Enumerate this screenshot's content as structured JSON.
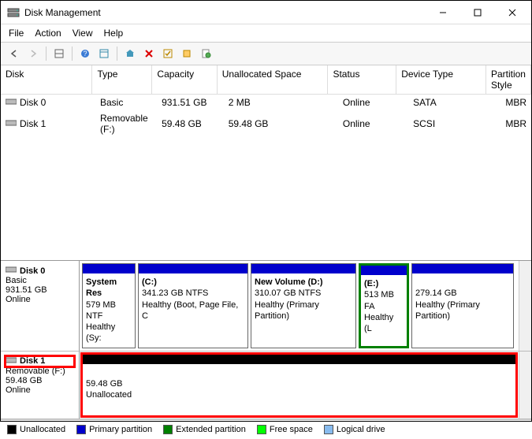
{
  "window": {
    "title": "Disk Management"
  },
  "menu": {
    "file": "File",
    "action": "Action",
    "view": "View",
    "help": "Help"
  },
  "columns": {
    "disk": "Disk",
    "type": "Type",
    "capacity": "Capacity",
    "unallocated": "Unallocated Space",
    "status": "Status",
    "device": "Device Type",
    "partition": "Partition Style"
  },
  "disks": [
    {
      "name": "Disk 0",
      "type": "Basic",
      "capacity": "931.51 GB",
      "unallocated": "2 MB",
      "status": "Online",
      "device": "SATA",
      "partition": "MBR"
    },
    {
      "name": "Disk 1",
      "type": "Removable (F:)",
      "capacity": "59.48 GB",
      "unallocated": "59.48 GB",
      "status": "Online",
      "device": "SCSI",
      "partition": "MBR"
    }
  ],
  "graph": {
    "disk0": {
      "name": "Disk 0",
      "sub1": "Basic",
      "sub2": "931.51 GB",
      "sub3": "Online",
      "vols": [
        {
          "title": "System Res",
          "line1": "579 MB NTF",
          "line2": "Healthy (Sy:"
        },
        {
          "title": "(C:)",
          "line1": "341.23 GB NTFS",
          "line2": "Healthy (Boot, Page File, C"
        },
        {
          "title": "New Volume  (D:)",
          "line1": "310.07 GB NTFS",
          "line2": "Healthy (Primary Partition)"
        },
        {
          "title": "(E:)",
          "line1": "513 MB FA",
          "line2": "Healthy (L"
        },
        {
          "title": "",
          "line1": "279.14 GB",
          "line2": "Healthy (Primary Partition)"
        }
      ]
    },
    "disk1": {
      "name": "Disk 1",
      "sub1": "Removable (F:)",
      "sub2": "59.48 GB",
      "sub3": "Online",
      "vol": {
        "line1": "59.48 GB",
        "line2": "Unallocated"
      }
    }
  },
  "legend": {
    "unallocated": "Unallocated",
    "primary": "Primary partition",
    "extended": "Extended partition",
    "free": "Free space",
    "logical": "Logical drive"
  }
}
